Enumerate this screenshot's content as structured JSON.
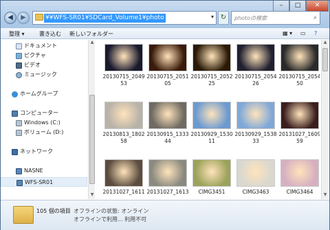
{
  "address": {
    "path": "¥¥WFS-SR01¥SDCard_Volume1¥photo"
  },
  "search": {
    "placeholder": "photoの検索"
  },
  "toolbar": {
    "organize": "整理 ▾",
    "burn": "書き込む",
    "new_folder": "新しいフォルダー"
  },
  "sidebar": {
    "items": [
      {
        "label": "ドキュメント"
      },
      {
        "label": "ピクチャ"
      },
      {
        "label": "ビデオ"
      },
      {
        "label": "ミュージック"
      },
      {
        "label": "ホームグループ"
      },
      {
        "label": "コンピューター"
      },
      {
        "label": "Windows (C:)"
      },
      {
        "label": "ボリューム (D:)"
      },
      {
        "label": "ネットワーク"
      },
      {
        "label": "NASNE"
      },
      {
        "label": "WFS-SR01"
      }
    ]
  },
  "files": [
    {
      "name": "20130715_204953",
      "color": "#1a1a2e"
    },
    {
      "name": "20130715_205105",
      "color": "#3a1a0a"
    },
    {
      "name": "20130715_205225",
      "color": "#2a1a05"
    },
    {
      "name": "20130715_205426",
      "color": "#202030"
    },
    {
      "name": "20130715_205450",
      "color": "#2a2a2a"
    },
    {
      "name": "20130813_180258",
      "color": "#b8b2a8"
    },
    {
      "name": "20130915_133344",
      "color": "#6f6a62"
    },
    {
      "name": "20130929_153011",
      "color": "#6c9ad0"
    },
    {
      "name": "20130929_153833",
      "color": "#7fa8d8"
    },
    {
      "name": "20131027_160959",
      "color": "#3a1e1e"
    },
    {
      "name": "20131027_1611",
      "color": "#5b4c3e"
    },
    {
      "name": "20131027_1613",
      "color": "#8a8a80"
    },
    {
      "name": "CIMG3451",
      "color": "#9ba25a"
    },
    {
      "name": "CIMG3463",
      "color": "#d8d8d0"
    },
    {
      "name": "CIMG3464",
      "color": "#d6b0c0"
    }
  ],
  "status": {
    "count": "105 個の項目",
    "offline_status": "オフラインの状態: オンライン",
    "offline_avail": "オフラインで利用... 利用不可"
  }
}
